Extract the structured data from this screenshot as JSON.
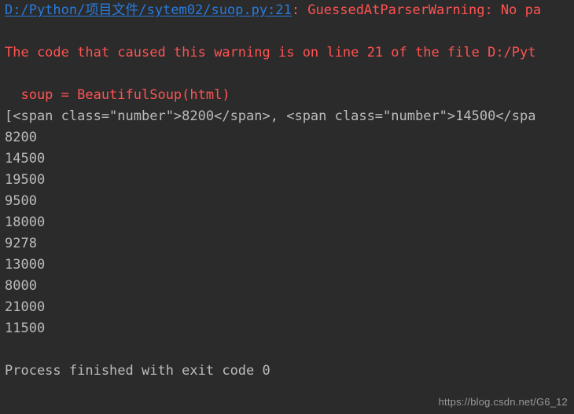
{
  "console": {
    "background_color": "#2b2b2b",
    "warning_color": "#ff5252",
    "output_color": "#bbbbbb",
    "link_color": "#287bde",
    "lines": [
      {
        "id": "warning-location",
        "link_text": "D:/Python/项目文件/sytem02/suop.py:21",
        "rest_text": ": GuessedAtParserWarning: No pa"
      },
      {
        "id": "blank-1",
        "text": ""
      },
      {
        "id": "warning-detail",
        "text": "The code that caused this warning is on line 21 of the file D:/Pyt"
      },
      {
        "id": "blank-2",
        "text": ""
      },
      {
        "id": "source-snippet",
        "text": "  soup = BeautifulSoup(html)"
      },
      {
        "id": "html-list-output",
        "text": "[<span class=\"number\">8200</span>, <span class=\"number\">14500</spa"
      },
      {
        "id": "value-1",
        "text": "8200"
      },
      {
        "id": "value-2",
        "text": "14500"
      },
      {
        "id": "value-3",
        "text": "19500"
      },
      {
        "id": "value-4",
        "text": "9500"
      },
      {
        "id": "value-5",
        "text": "18000"
      },
      {
        "id": "value-6",
        "text": "9278"
      },
      {
        "id": "value-7",
        "text": "13000"
      },
      {
        "id": "value-8",
        "text": "8000"
      },
      {
        "id": "value-9",
        "text": "21000"
      },
      {
        "id": "value-10",
        "text": "11500"
      },
      {
        "id": "blank-3",
        "text": ""
      },
      {
        "id": "process-exit",
        "text": "Process finished with exit code 0"
      }
    ]
  },
  "watermark": {
    "text": "https://blog.csdn.net/G6_12"
  }
}
